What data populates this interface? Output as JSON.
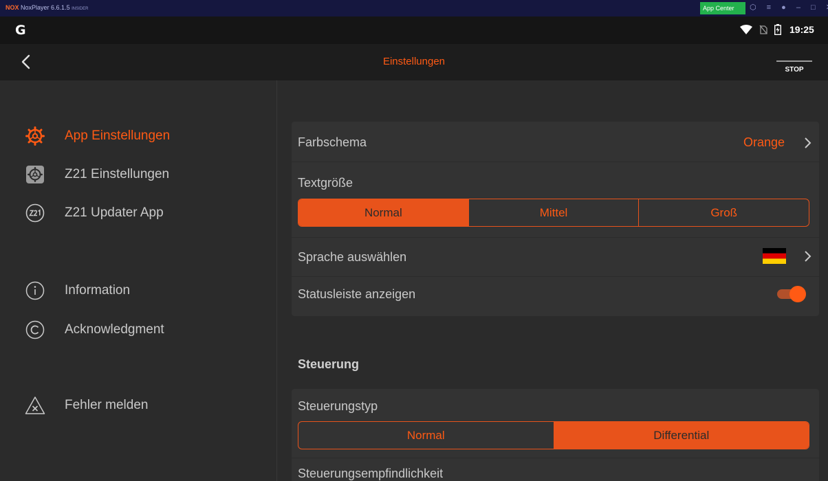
{
  "emulator": {
    "brand": "NOX",
    "title": "NoxPlayer 6.6.1.5",
    "version_tag": "INSIDER",
    "app_center_label": "App Center",
    "controls_text": "⬡ ≡ ● – □ ✕"
  },
  "status_bar": {
    "logo_letter": "G",
    "time": "19:25"
  },
  "app_bar": {
    "title": "Einstellungen",
    "stop_label": "STOP"
  },
  "sidebar": {
    "items": [
      {
        "label": "App Einstellungen",
        "icon": "gear-icon",
        "active": true
      },
      {
        "label": "Z21 Einstellungen",
        "icon": "gear-badge-icon",
        "active": false
      },
      {
        "label": "Z21 Updater App",
        "icon": "z21-icon",
        "active": false
      },
      {
        "label": "Information",
        "icon": "info-icon",
        "active": false
      },
      {
        "label": "Acknowledgment",
        "icon": "copyright-icon",
        "active": false
      },
      {
        "label": "Fehler melden",
        "icon": "error-report-icon",
        "active": false
      }
    ]
  },
  "settings": {
    "color_scheme": {
      "label": "Farbschema",
      "value": "Orange"
    },
    "text_size": {
      "label": "Textgröße",
      "options": [
        "Normal",
        "Mittel",
        "Groß"
      ],
      "selected": "Normal"
    },
    "language": {
      "label": "Sprache auswählen",
      "flag": "german-flag-icon"
    },
    "status_bar": {
      "label": "Statusleiste anzeigen",
      "enabled": true
    }
  },
  "control": {
    "section_title": "Steuerung",
    "type": {
      "label": "Steuerungstyp",
      "options": [
        "Normal",
        "Differential"
      ],
      "selected": "Differential"
    },
    "sensitivity_label": "Steuerungsempfindlichkeit"
  },
  "colors": {
    "accent": "#ff5a14",
    "background": "#2b2b2b",
    "card": "#333333"
  }
}
